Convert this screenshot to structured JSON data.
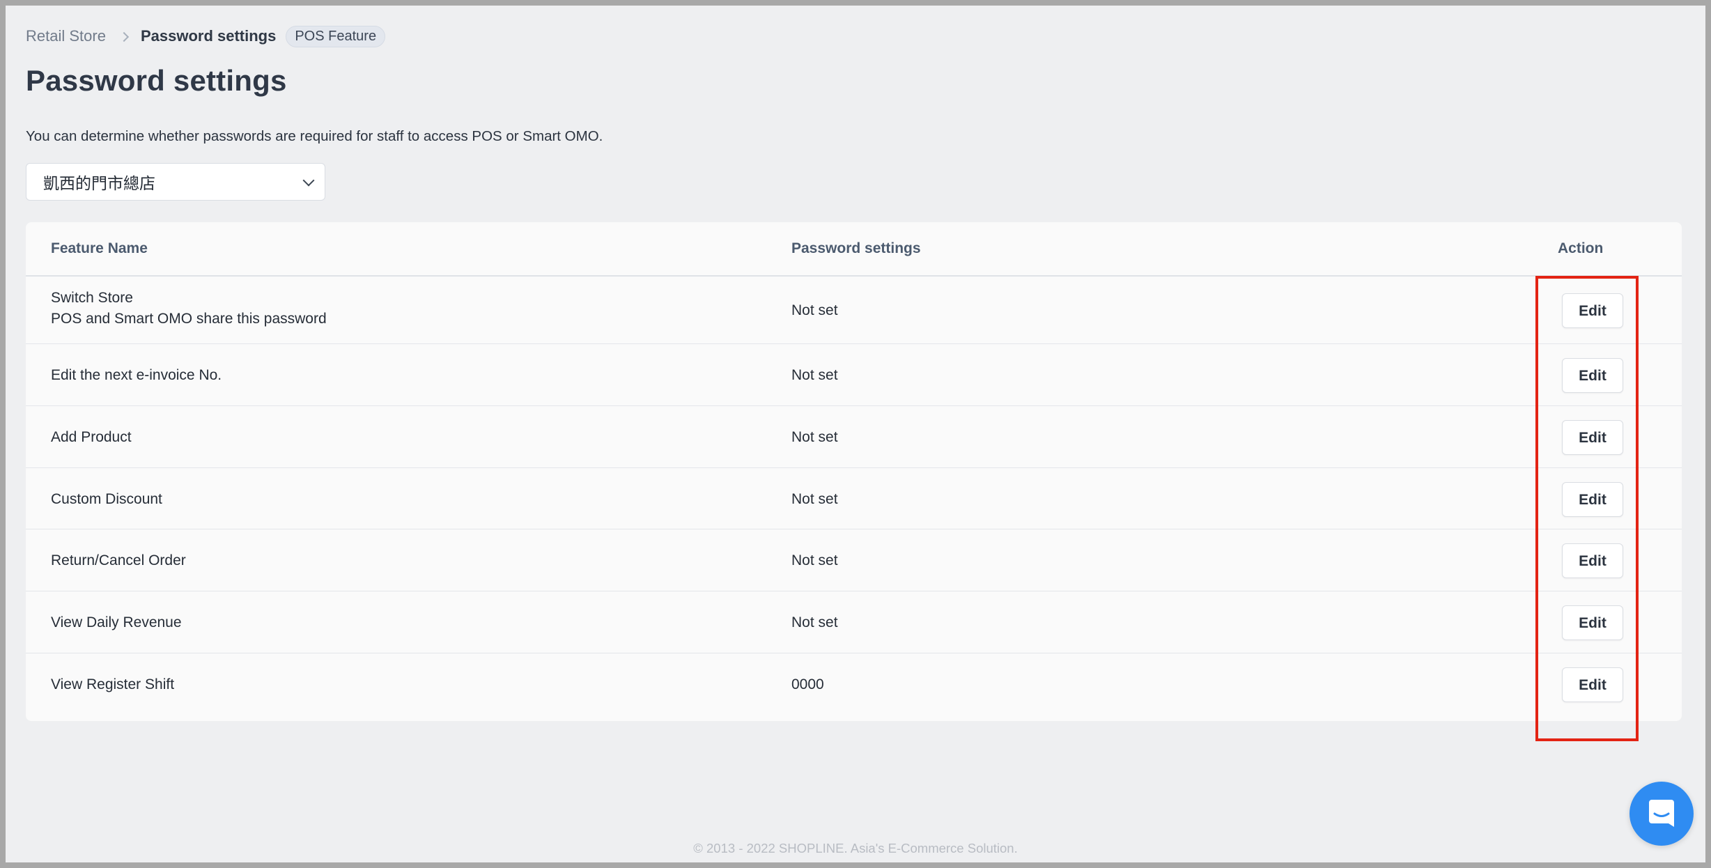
{
  "breadcrumb": {
    "root": "Retail Store",
    "current": "Password settings",
    "badge": "POS Feature"
  },
  "page": {
    "title": "Password settings",
    "description": "You can determine whether passwords are required for staff to access POS or Smart OMO."
  },
  "store_select": {
    "value": "凱西的門市總店"
  },
  "table": {
    "headers": {
      "feature_name": "Feature Name",
      "password_settings": "Password settings",
      "action": "Action"
    },
    "rows": [
      {
        "name": "Switch Store",
        "note": "POS and Smart OMO share this password",
        "setting": "Not set",
        "action": "Edit"
      },
      {
        "name": "Edit the next e-invoice No.",
        "setting": "Not set",
        "action": "Edit"
      },
      {
        "name": "Add Product",
        "setting": "Not set",
        "action": "Edit"
      },
      {
        "name": "Custom Discount",
        "setting": "Not set",
        "action": "Edit"
      },
      {
        "name": "Return/Cancel Order",
        "setting": "Not set",
        "action": "Edit"
      },
      {
        "name": "View Daily Revenue",
        "setting": "Not set",
        "action": "Edit"
      },
      {
        "name": "View Register Shift",
        "setting": "0000",
        "action": "Edit"
      }
    ]
  },
  "footer": {
    "text": "© 2013 - 2022 SHOPLINE. Asia's E-Commerce Solution."
  },
  "colors": {
    "highlight": "#e32414",
    "chat_launcher": "#2f8cf2",
    "page_background": "#eeeff1"
  },
  "icons": {
    "breadcrumb_separator": "chevron-right-icon",
    "select_arrow": "chevron-down-icon",
    "chat_launcher": "chat-icon"
  }
}
